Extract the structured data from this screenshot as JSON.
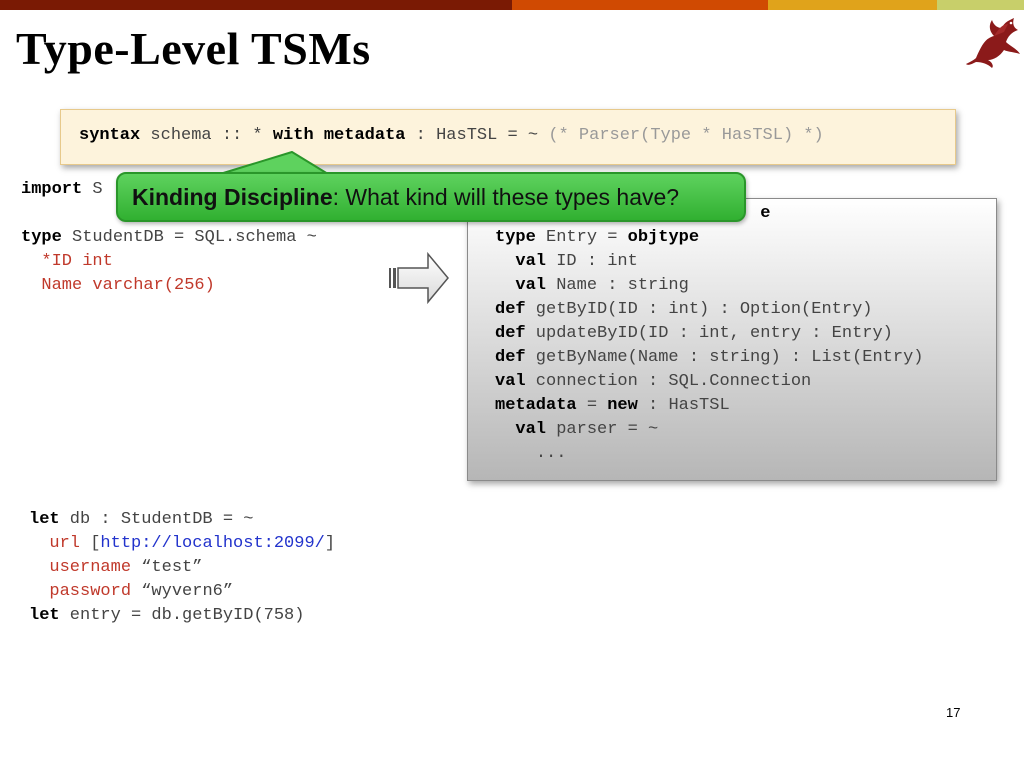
{
  "colors": {
    "bar1": "#7a1a04",
    "bar2": "#d04a02",
    "bar3": "#e0a31b",
    "bar4": "#c8cf6a",
    "callout_green": "#3fbe3f",
    "syntax_fill": "#fdf3dc",
    "keyword_red": "#c0392b",
    "link_blue": "#2233cc"
  },
  "slide": {
    "title": "Type-Level TSMs",
    "page_number": "17",
    "logo_icon": "dragon-logo-icon",
    "arrow_icon": "right-arrow-icon"
  },
  "syntax_box": {
    "kw_syntax": "syntax",
    "t1": " schema :: * ",
    "kw_with": "with",
    "kw_metadata": " metadata",
    "t2": " : HasTSL = ~ ",
    "comment": "(* Parser(Type * HasTSL) *)"
  },
  "callout": {
    "bold": "Kinding Discipline",
    "rest": ": What kind will these types have?"
  },
  "left_code": {
    "l1_kw": "import",
    "l1_rest": " S",
    "l3_kw": "type",
    "l3_rest": " StudentDB = SQL.schema ~",
    "l4": "  *ID int",
    "l5": "  Name varchar(256)"
  },
  "gen_code": {
    "l0_end": "e",
    "l1_kw": "type",
    "l1_mid": " Entry = ",
    "l1_kw2": "objtype",
    "l2_kw": "val",
    "l2_rest": " ID : int",
    "l3_kw": "val",
    "l3_rest": " Name : string",
    "l4_kw": "def",
    "l4_rest": " getByID(ID : int) : Option(Entry)",
    "l5_kw": "def",
    "l5_rest": " updateByID(ID : int, entry : Entry)",
    "l6_kw": "def",
    "l6_rest": " getByName(Name : string) : List(Entry)",
    "l7_kw": "val",
    "l7_rest": " connection : SQL.Connection",
    "l8_kw": "metadata",
    "l8_mid": " = ",
    "l8_kw2": "new",
    "l8_rest": " : HasTSL",
    "l9_kw": "val",
    "l9_rest": " parser = ~",
    "l10": "..."
  },
  "bottom_code": {
    "l1_kw": "let",
    "l1_rest": " db : StudentDB = ~",
    "l2_key": "url",
    "l2_open": " [",
    "l2_link": "http://localhost:2099/",
    "l2_close": "]",
    "l3_key": "username",
    "l3_val": " “test”",
    "l4_key": "password",
    "l4_val": " “wyvern6”",
    "l5_kw": "let",
    "l5_rest": " entry = db.getByID(758)"
  }
}
